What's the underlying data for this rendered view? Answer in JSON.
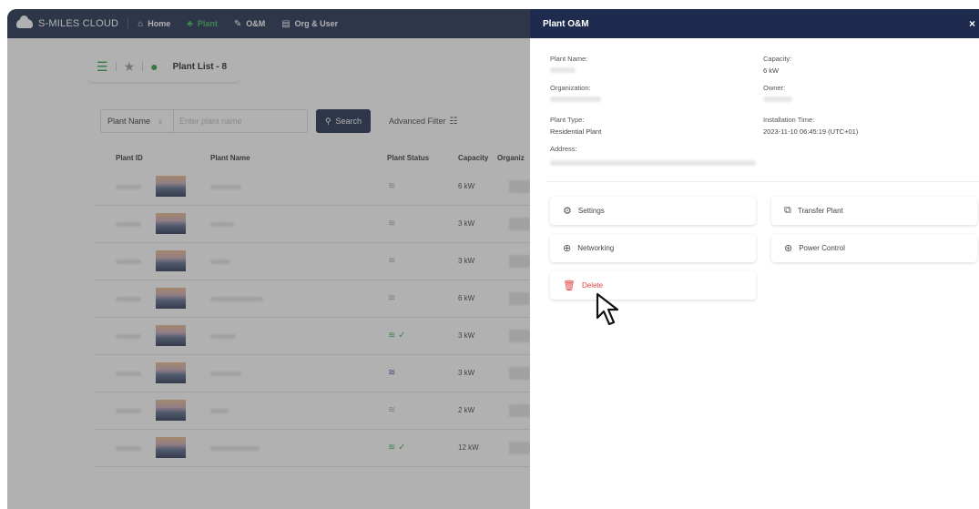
{
  "brand": {
    "name": "S-MILES CLOUD"
  },
  "nav": [
    {
      "label": "Home",
      "icon": "home-icon",
      "glyph": "⌂",
      "active": false
    },
    {
      "label": "Plant",
      "icon": "plant-icon",
      "glyph": "♣",
      "active": true
    },
    {
      "label": "O&M",
      "icon": "wrench-icon",
      "glyph": "✎",
      "active": false
    },
    {
      "label": "Org & User",
      "icon": "document-icon",
      "glyph": "▤",
      "active": false
    }
  ],
  "toolbar": {
    "title": "Plant List - 8"
  },
  "filter": {
    "select_value": "Plant Name",
    "input_placeholder": "Enter plant name",
    "search_label": "Search",
    "advanced_label": "Advanced Filter"
  },
  "table": {
    "headers": {
      "id": "Plant ID",
      "name": "Plant Name",
      "status": "Plant Status",
      "capacity": "Capacity",
      "org": "Organiz"
    },
    "rows": [
      {
        "status": "offline-wifi",
        "capacity": "6 kW"
      },
      {
        "status": "offline-wifi",
        "capacity": "3 kW"
      },
      {
        "status": "offline-wifi",
        "capacity": "3 kW"
      },
      {
        "status": "offline-wifi",
        "capacity": "6 kW"
      },
      {
        "status": "online",
        "capacity": "3 kW"
      },
      {
        "status": "offline",
        "capacity": "3 kW"
      },
      {
        "status": "offline-wifi",
        "capacity": "2 kW"
      },
      {
        "status": "online",
        "capacity": "12 kW"
      }
    ]
  },
  "drawer": {
    "title": "Plant O&M",
    "close": "×",
    "fields": {
      "plant_name_label": "Plant Name:",
      "capacity_label": "Capacity:",
      "capacity_value": "6 kW",
      "organization_label": "Organization:",
      "owner_label": "Owner:",
      "plant_type_label": "Plant Type:",
      "plant_type_value": "Residential Plant",
      "installation_time_label": "Installation Time:",
      "installation_time_value": "2023-11-10 06:45:19 (UTC+01)",
      "address_label": "Address:"
    },
    "actions": {
      "settings": "Settings",
      "transfer": "Transfer Plant",
      "networking": "Networking",
      "power_control": "Power Control",
      "delete": "Delete"
    }
  },
  "colors": {
    "nav_bg": "#1e2b4f",
    "accent_green": "#3fb55a",
    "danger": "#e04545"
  }
}
